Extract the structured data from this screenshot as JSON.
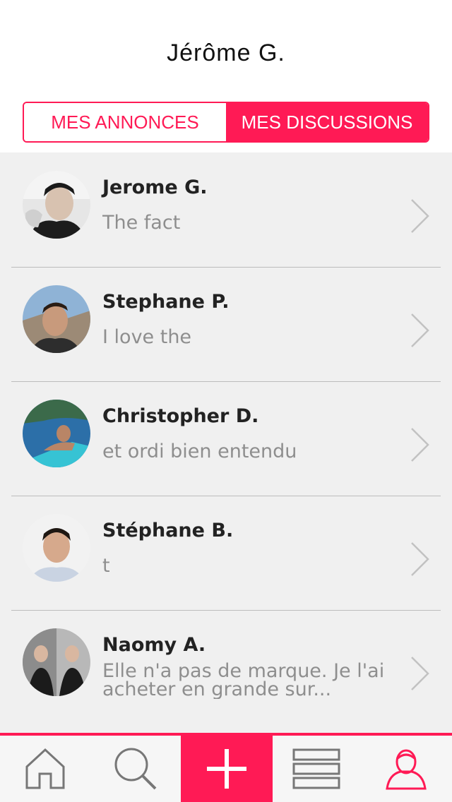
{
  "header": {
    "title": "Jérôme G."
  },
  "segmented": {
    "items": [
      {
        "label": "MES ANNONCES",
        "active": false
      },
      {
        "label": "MES DISCUSSIONS",
        "active": true
      }
    ]
  },
  "conversations": [
    {
      "name": "Jerome G.",
      "message": "The fact"
    },
    {
      "name": "Stephane P.",
      "message": "I love the"
    },
    {
      "name": "Christopher D.",
      "message": "et ordi bien entendu"
    },
    {
      "name": "Stéphane B.",
      "message": "t"
    },
    {
      "name": "Naomy A.",
      "message": "Elle n'a pas de marque. Je l'ai acheter en grande sur..."
    }
  ],
  "tabbar": {
    "items": [
      {
        "icon": "home-icon"
      },
      {
        "icon": "search-icon"
      },
      {
        "icon": "plus-icon"
      },
      {
        "icon": "list-icon"
      },
      {
        "icon": "profile-icon"
      }
    ]
  },
  "colors": {
    "accent": "#ff1a55",
    "list_background": "#f0f0f0",
    "message_text": "#8e8e8e"
  }
}
